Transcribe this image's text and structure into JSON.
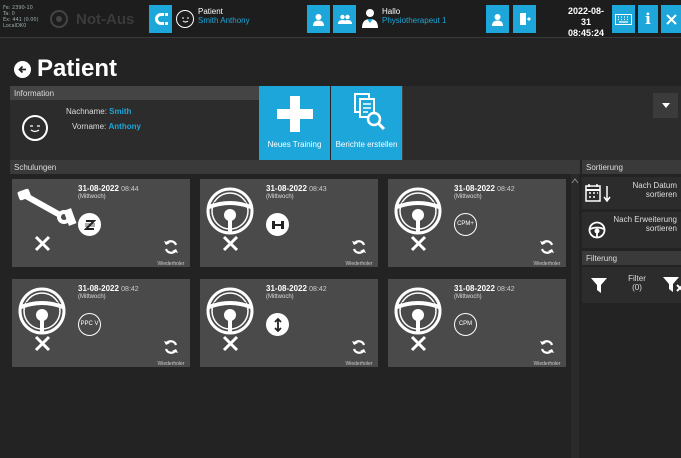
{
  "sysinfo": [
    "Fe: 2390-10",
    "Ta: 0",
    "Ex: 441 (0.00)",
    "LocalDK0"
  ],
  "top": {
    "notaus_label": "Not-Aus",
    "patient_label": "Patient",
    "patient_name": "Smith Anthony",
    "user_greeting": "Hallo",
    "user_role": "Physiotherapeut 1",
    "date": "2022-08-31",
    "time": "08:45:24"
  },
  "page_title": "Patient",
  "information": {
    "header": "Information",
    "lastname_label": "Nachname:",
    "lastname": "Smith",
    "firstname_label": "Vorname:",
    "firstname": "Anthony",
    "new_training": "Neues Training",
    "create_reports": "Berichte erstellen"
  },
  "schulungen": {
    "header": "Schulungen",
    "repeat_label": "Wiederholer",
    "cards": [
      {
        "date": "31-08-2022",
        "time": "08:44",
        "weekday": "(Mittwoch)",
        "device": "crank-lever",
        "mode_icon": "z-mode-icon",
        "mode_text": ""
      },
      {
        "date": "31-08-2022",
        "time": "08:43",
        "weekday": "(Mittwoch)",
        "device": "steering-wheel",
        "mode_icon": "h-mode-icon",
        "mode_text": ""
      },
      {
        "date": "31-08-2022",
        "time": "08:42",
        "weekday": "(Mittwoch)",
        "device": "steering-wheel",
        "mode_icon": "cpm-plus-icon",
        "mode_text": "CPM+"
      },
      {
        "date": "31-08-2022",
        "time": "08:42",
        "weekday": "(Mittwoch)",
        "device": "steering-wheel",
        "mode_icon": "ppcv-icon",
        "mode_text": "PPC V"
      },
      {
        "date": "31-08-2022",
        "time": "08:42",
        "weekday": "(Mittwoch)",
        "device": "steering-wheel",
        "mode_icon": "vertical-arrows-icon",
        "mode_text": ""
      },
      {
        "date": "31-08-2022",
        "time": "08:42",
        "weekday": "(Mittwoch)",
        "device": "steering-wheel",
        "mode_icon": "cpm-icon",
        "mode_text": "CPM"
      }
    ]
  },
  "sortierung": {
    "header": "Sortierung",
    "by_date": "Nach Datum sortieren",
    "by_extension": "Nach Erweiterung sortieren"
  },
  "filterung": {
    "header": "Filterung",
    "filter_label": "Filter",
    "filter_count": "(0)"
  },
  "colors": {
    "accent": "#1da6d9",
    "card": "#4a4a4a",
    "background": "#232323"
  }
}
